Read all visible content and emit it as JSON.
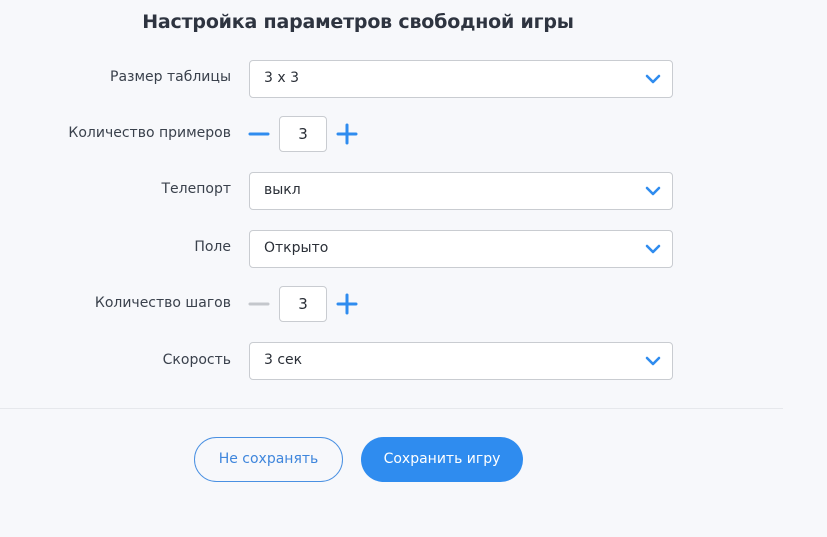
{
  "title": "Настройка параметров свободной игры",
  "rows": {
    "table_size": {
      "label": "Размер таблицы",
      "value": "3 х 3"
    },
    "examples": {
      "label": "Количество примеров",
      "value": "3",
      "minus_enabled": true
    },
    "teleport": {
      "label": "Телепорт",
      "value": "выкл"
    },
    "field": {
      "label": "Поле",
      "value": "Открыто"
    },
    "steps": {
      "label": "Количество шагов",
      "value": "3",
      "minus_enabled": false
    },
    "speed": {
      "label": "Скорость",
      "value": "3 сек"
    }
  },
  "buttons": {
    "cancel": "Не сохранять",
    "save": "Сохранить игру"
  },
  "colors": {
    "accent": "#2f8cef",
    "disabled": "#c4c7cc"
  },
  "icons": {
    "chevron": "chevron-down-icon",
    "minus": "minus-icon",
    "plus": "plus-icon"
  }
}
